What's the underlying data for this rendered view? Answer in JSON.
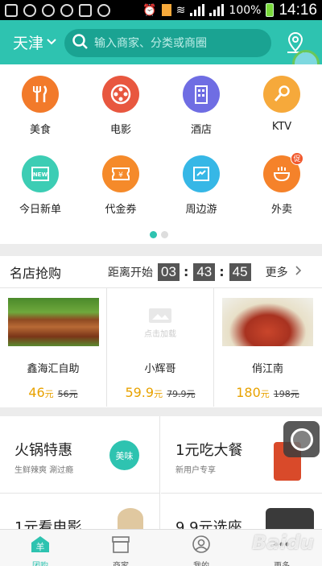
{
  "status_bar": {
    "time": "14:16",
    "battery": "100%"
  },
  "header": {
    "city": "天津",
    "search_placeholder": "输入商家、分类或商圈"
  },
  "categories": [
    {
      "label": "美食",
      "icon": "fork-knife-icon",
      "color": "#f27a2a"
    },
    {
      "label": "电影",
      "icon": "film-reel-icon",
      "color": "#e8573f"
    },
    {
      "label": "酒店",
      "icon": "building-icon",
      "color": "#6f6de3"
    },
    {
      "label": "KTV",
      "icon": "microphone-icon",
      "color": "#f6a93b"
    },
    {
      "label": "今日新单",
      "icon": "new-tag-icon",
      "color": "#3ccdb4"
    },
    {
      "label": "代金券",
      "icon": "voucher-icon",
      "color": "#f58a2a"
    },
    {
      "label": "周边游",
      "icon": "travel-icon",
      "color": "#36b7e6"
    },
    {
      "label": "外卖",
      "icon": "bowl-icon",
      "color": "#f5822a",
      "badge": "促"
    }
  ],
  "flash": {
    "title": "名店抢购",
    "countdown_label": "距离开始",
    "hours": "03",
    "minutes": "43",
    "seconds": "45",
    "more": "更多",
    "items": [
      {
        "name": "鑫海汇自助",
        "price": "46",
        "unit": "元",
        "old": "56元",
        "thumb": "meat"
      },
      {
        "name": "小辉哥",
        "price": "59.9",
        "unit": "元",
        "old": "79.9元",
        "thumb": "placeholder",
        "placeholder_text": "点击加载"
      },
      {
        "name": "俏江南",
        "price": "180",
        "unit": "元",
        "old": "198元",
        "thumb": "crab"
      }
    ]
  },
  "promos": [
    {
      "title": "火锅特惠",
      "sub": "生鲜辣爽 涮过瘾",
      "badge": "美味"
    },
    {
      "title": "1元吃大餐",
      "sub": "新用户专享"
    },
    {
      "title": "1元看电影"
    },
    {
      "title": "9.9元选座"
    }
  ],
  "tabs": [
    {
      "label": "团购",
      "icon": "group-buy-icon",
      "active": true
    },
    {
      "label": "商家",
      "icon": "store-icon"
    },
    {
      "label": "我的",
      "icon": "user-icon"
    },
    {
      "label": "更多",
      "icon": "more-icon"
    }
  ],
  "watermark": "Baidu"
}
